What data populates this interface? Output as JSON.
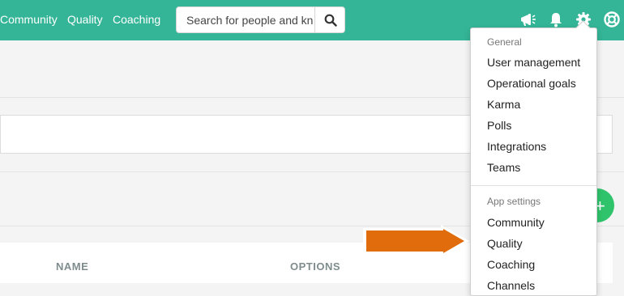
{
  "topnav": {
    "links": [
      "Community",
      "Quality",
      "Coaching"
    ],
    "search": {
      "placeholder": "Search for people and kn"
    },
    "icons": [
      "megaphone-icon",
      "bell-icon",
      "gear-icon",
      "help-icon"
    ]
  },
  "table": {
    "headers": [
      "NAME",
      "OPTIONS"
    ]
  },
  "settings_menu": {
    "general_header": "General",
    "general_items": [
      "User management",
      "Operational goals",
      "Karma",
      "Polls",
      "Integrations",
      "Teams"
    ],
    "app_header": "App settings",
    "app_items": [
      "Community",
      "Quality",
      "Coaching",
      "Channels"
    ]
  },
  "colors": {
    "brand": "#35b597",
    "fab": "#2fc46c",
    "callout": "#e06c0b"
  }
}
